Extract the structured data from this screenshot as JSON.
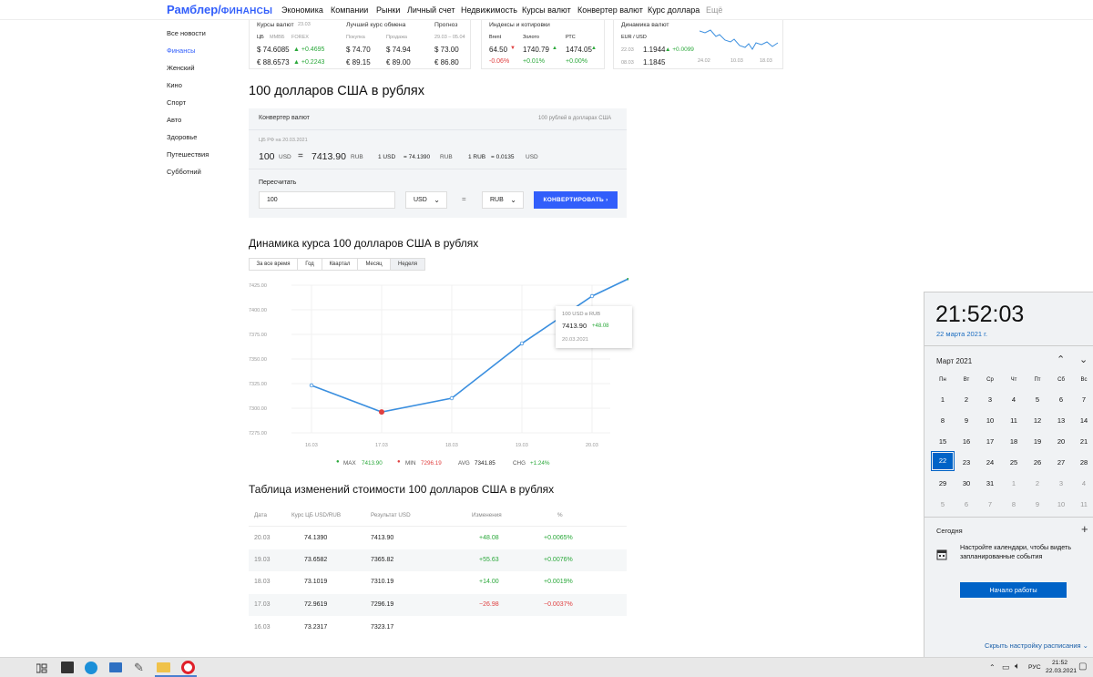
{
  "header": {
    "logo": "Рамблер/",
    "logo_sub": "ФИНАНСЫ",
    "nav": [
      "Экономика",
      "Компании",
      "Рынки",
      "Личный счет",
      "Недвижимость",
      "Курсы валют",
      "Конвертер валют",
      "Курс доллара"
    ],
    "more": "Ещё"
  },
  "sidebar": [
    "Все новости",
    "Финансы",
    "Женский",
    "Кино",
    "Спорт",
    "Авто",
    "Здоровье",
    "Путешествия",
    "Субботний"
  ],
  "rates": {
    "title": "Курсы валют",
    "date": "23.03",
    "src1": "ЦБ",
    "src2": "ММВБ",
    "src3": "FOREX",
    "usd": "$ 74.6085",
    "usd_ch": "+0.4695",
    "eur": "€ 88.6573",
    "eur_ch": "+0.2243",
    "best_title": "Лучший курс обмена",
    "buy": "Покупка",
    "sell": "Продажа",
    "buy_usd": "$ 74.70",
    "sell_usd": "$ 74.94",
    "buy_eur": "€ 89.15",
    "sell_eur": "€ 89.00",
    "fc_title": "Прогноз",
    "fc_range": "29.03 – 05.04",
    "fc_usd": "$ 73.00",
    "fc_eur": "€ 86.80",
    "idx_title": "Индексы и котировки",
    "brent": "Brent",
    "gold": "Золото",
    "rts": "РТС",
    "brent_v": "64.50",
    "gold_v": "1740.79",
    "rts_v": "1474.05",
    "brent_c": "-0.06%",
    "gold_c": "+0.01%",
    "rts_c": "+0.00%",
    "dyn_title": "Динамика валют",
    "pair": "EUR / USD",
    "d1": "22.03",
    "v1": "1.1944",
    "c1": "+0.0099",
    "d2": "08.03",
    "v2": "1.1845",
    "ax": [
      "24.02",
      "10.03",
      "18.03"
    ]
  },
  "main": {
    "title": "100 долларов США в рублях",
    "conv_title": "Конвертер валют",
    "conv_link": "100 рублей в долларах США",
    "cb_note": "ЦБ РФ на 20.03.2021",
    "amount": "100",
    "amount_cur": "USD",
    "eq": "=",
    "result": "7413.90",
    "result_cur": "RUB",
    "r1": "1 USD",
    "r1eq": "= 74.1390",
    "r1cur": "RUB",
    "r2": "1 RUB",
    "r2eq": "= 0.0135",
    "r2cur": "USD",
    "recalc": "Пересчитать",
    "input_val": "100",
    "from": "USD",
    "to": "RUB",
    "btn": "КОНВЕРТИРОВАТЬ ›"
  },
  "dynamics": {
    "title": "Динамика курса 100 долларов США в рублях",
    "tabs": [
      "За все время",
      "Год",
      "Квартал",
      "Месяц",
      "Неделя"
    ],
    "tooltip_title": "100 USD в RUB",
    "tooltip_val": "7413.90",
    "tooltip_ch": "+48.08",
    "tooltip_date": "20.03.2021",
    "stats": {
      "max_l": "MAX",
      "max_v": "7413.90",
      "min_l": "MIN",
      "min_v": "7296.19",
      "avg_l": "AVG",
      "avg_v": "7341.85",
      "chg_l": "CHG",
      "chg_v": "+1.24%"
    }
  },
  "chart_data": {
    "type": "line",
    "x": [
      "16.03",
      "17.03",
      "18.03",
      "19.03",
      "20.03"
    ],
    "values": [
      7323.17,
      7296.19,
      7310.19,
      7365.82,
      7413.9
    ],
    "ylim": [
      7275,
      7425
    ],
    "yticks": [
      "7425.00",
      "7400.00",
      "7375.00",
      "7350.00",
      "7325.00",
      "7300.00",
      "7275.00"
    ],
    "color": "#3b8fdf"
  },
  "table": {
    "title": "Таблица изменений стоимости 100 долларов США в рублях",
    "headers": [
      "Дата",
      "Курс ЦБ USD/RUB",
      "Результат USD",
      "Изменения",
      "%"
    ],
    "rows": [
      [
        "20.03",
        "74.1390",
        "7413.90",
        "+48.08",
        "+0.0065%"
      ],
      [
        "19.03",
        "73.6582",
        "7365.82",
        "+55.63",
        "+0.0076%"
      ],
      [
        "18.03",
        "73.1019",
        "7310.19",
        "+14.00",
        "+0.0019%"
      ],
      [
        "17.03",
        "72.9619",
        "7296.19",
        "−26.98",
        "−0.0037%"
      ],
      [
        "16.03",
        "73.2317",
        "7323.17",
        "",
        ""
      ]
    ]
  },
  "calendar": {
    "time": "21:52:03",
    "date": "22 марта 2021 г.",
    "month": "Март 2021",
    "weekdays": [
      "Пн",
      "Вт",
      "Ср",
      "Чт",
      "Пт",
      "Сб",
      "Вс"
    ],
    "weeks": [
      [
        "1",
        "2",
        "3",
        "4",
        "5",
        "6",
        "7"
      ],
      [
        "8",
        "9",
        "10",
        "11",
        "12",
        "13",
        "14"
      ],
      [
        "15",
        "16",
        "17",
        "18",
        "19",
        "20",
        "21"
      ],
      [
        "22",
        "23",
        "24",
        "25",
        "26",
        "27",
        "28"
      ],
      [
        "29",
        "30",
        "31",
        "1",
        "2",
        "3",
        "4"
      ],
      [
        "5",
        "6",
        "7",
        "8",
        "9",
        "10",
        "11"
      ]
    ],
    "today_label": "Сегодня",
    "agenda": "Настройте календари, чтобы видеть запланированные события",
    "start": "Начало работы",
    "hide": "Скрыть настройку расписания"
  },
  "taskbar": {
    "lang": "РУС",
    "time": "21:52",
    "date": "22.03.2021"
  }
}
